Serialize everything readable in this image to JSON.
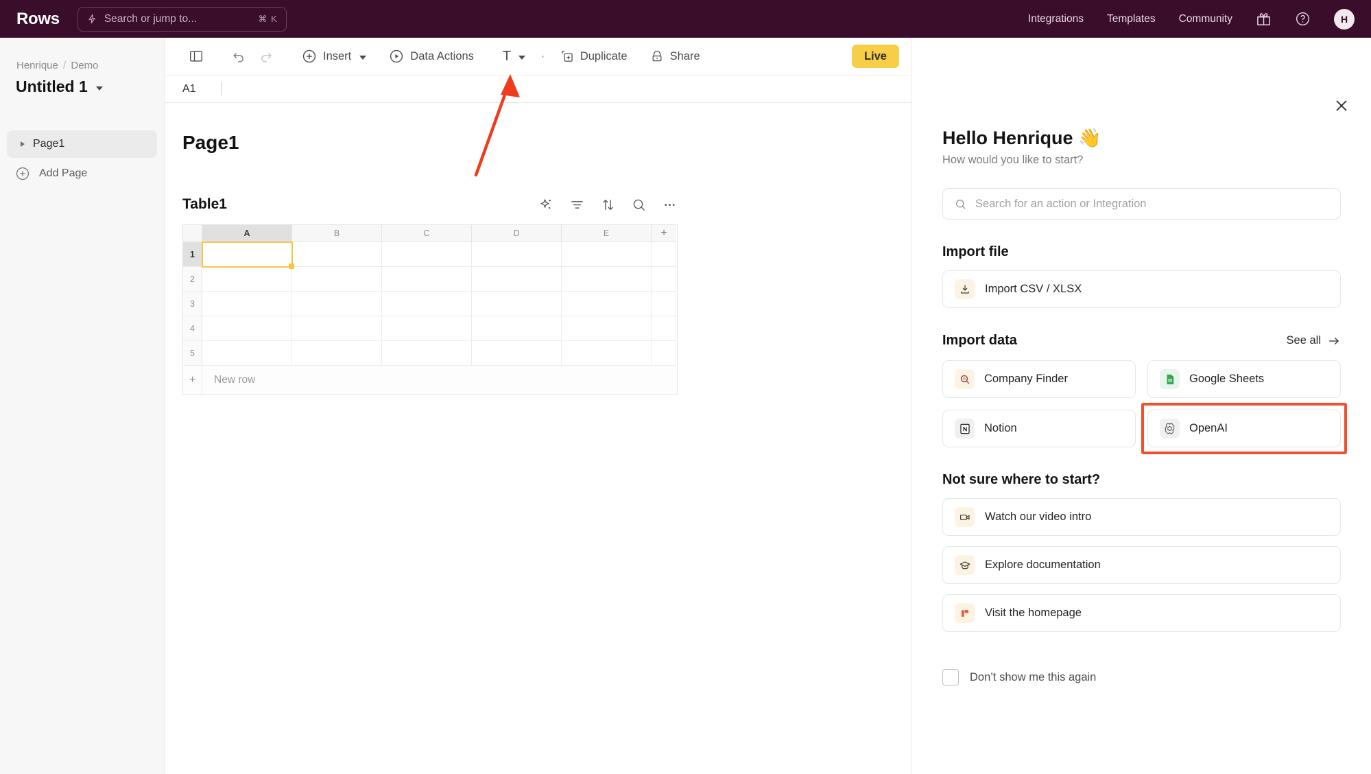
{
  "topbar": {
    "brand": "Rows",
    "search_placeholder": "Search or jump to...",
    "search_shortcut": "⌘ K",
    "nav": [
      {
        "label": "Integrations"
      },
      {
        "label": "Templates"
      },
      {
        "label": "Community"
      }
    ],
    "gift_icon": "gift-icon",
    "help_icon": "help-circle-icon",
    "avatar_initial": "H"
  },
  "sidebar": {
    "breadcrumb_workspace": "Henrique",
    "breadcrumb_sep": "/",
    "breadcrumb_folder": "Demo",
    "doc_title": "Untitled 1",
    "pages": [
      {
        "label": "Page1"
      }
    ],
    "add_page_label": "Add Page"
  },
  "toolbar": {
    "sidebar_toggle": "panel-toggle-icon",
    "undo": "undo-icon",
    "redo": "redo-icon",
    "insert_label": "Insert",
    "data_actions_label": "Data Actions",
    "text_tool": "T",
    "more_dot": "·",
    "duplicate_label": "Duplicate",
    "share_label": "Share",
    "live_label": "Live"
  },
  "formula_bar": {
    "cell_ref": "A1",
    "value": ""
  },
  "sheet": {
    "page_heading": "Page1",
    "table_title": "Table1",
    "tools": [
      {
        "name": "ai-sparkle-icon"
      },
      {
        "name": "filter-icon"
      },
      {
        "name": "sort-icon"
      },
      {
        "name": "search-icon"
      },
      {
        "name": "more-options-icon"
      }
    ],
    "columns": [
      "A",
      "B",
      "C",
      "D",
      "E"
    ],
    "add_column_label": "+",
    "rows": [
      "1",
      "2",
      "3",
      "4",
      "5"
    ],
    "selected_cell": "A1",
    "new_row_label": "New row",
    "new_row_plus": "+"
  },
  "panel": {
    "close_icon": "close-icon",
    "greeting": "Hello Henrique 👋",
    "greeting_sub": "How would you like to start?",
    "search_placeholder": "Search for an action or Integration",
    "import_file_title": "Import file",
    "import_file_items": [
      {
        "label": "Import CSV / XLSX",
        "icon": "download-icon"
      }
    ],
    "import_data_title": "Import data",
    "see_all_label": "See all",
    "import_data_tiles": [
      {
        "label": "Company Finder",
        "icon": "company-finder-icon",
        "highlighted": false
      },
      {
        "label": "Google Sheets",
        "icon": "google-sheets-icon",
        "highlighted": false
      },
      {
        "label": "Notion",
        "icon": "notion-icon",
        "highlighted": false
      },
      {
        "label": "OpenAI",
        "icon": "openai-icon",
        "highlighted": true
      }
    ],
    "not_sure_title": "Not sure where to start?",
    "help_items": [
      {
        "label": "Watch our video intro",
        "icon": "video-camera-icon"
      },
      {
        "label": "Explore documentation",
        "icon": "graduation-cap-icon"
      },
      {
        "label": "Visit the homepage",
        "icon": "rows-logo-icon"
      }
    ],
    "dont_show_label": "Don’t show me this again",
    "dont_show_checked": false
  },
  "annotation": {
    "arrow_color": "#F03C1E",
    "points_to": "Data Actions"
  },
  "colors": {
    "topbar_bg": "#3A0D2A",
    "live_yellow": "#F7CE46",
    "selection_amber": "#F6C544",
    "highlight_red": "#F1502F"
  }
}
